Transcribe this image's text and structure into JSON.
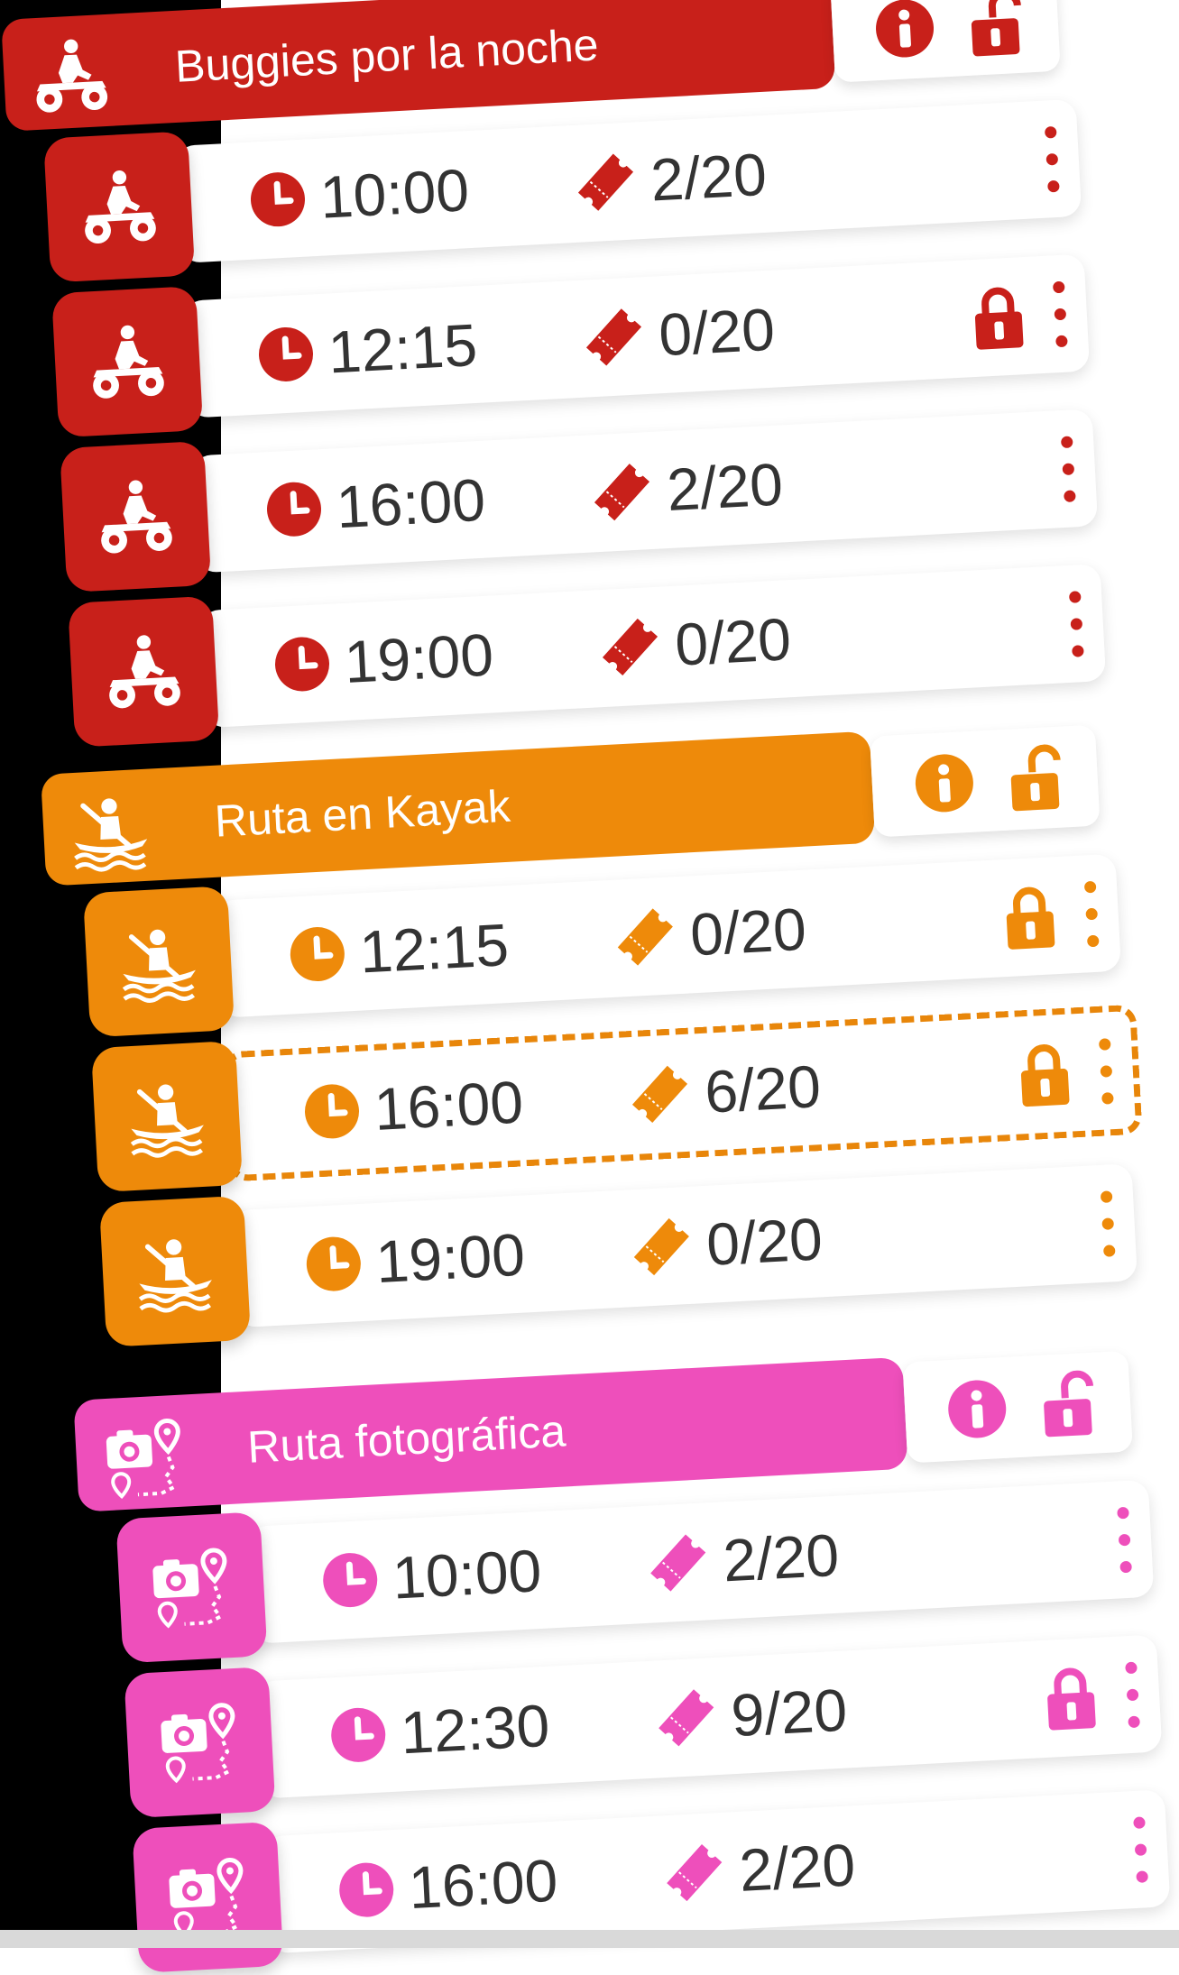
{
  "colors": {
    "buggies": "#c8201a",
    "kayak": "#ee8a0a",
    "foto": "#ee4fbb",
    "text": "#333333"
  },
  "groups": [
    {
      "title": "Buggies por la noche",
      "icon": "quad-bike-icon",
      "color": "#c8201a",
      "slots": [
        {
          "time": "10:00",
          "tickets": "2/20",
          "locked": false,
          "selected": false
        },
        {
          "time": "12:15",
          "tickets": "0/20",
          "locked": true,
          "selected": false
        },
        {
          "time": "16:00",
          "tickets": "2/20",
          "locked": false,
          "selected": false
        },
        {
          "time": "19:00",
          "tickets": "0/20",
          "locked": false,
          "selected": false
        }
      ]
    },
    {
      "title": "Ruta en Kayak",
      "icon": "kayak-icon",
      "color": "#ee8a0a",
      "slots": [
        {
          "time": "12:15",
          "tickets": "0/20",
          "locked": true,
          "selected": false
        },
        {
          "time": "16:00",
          "tickets": "6/20",
          "locked": true,
          "selected": true
        },
        {
          "time": "19:00",
          "tickets": "0/20",
          "locked": false,
          "selected": false
        }
      ]
    },
    {
      "title": "Ruta fotográfica",
      "icon": "camera-route-icon",
      "color": "#ee4fbb",
      "slots": [
        {
          "time": "10:00",
          "tickets": "2/20",
          "locked": false,
          "selected": false
        },
        {
          "time": "12:30",
          "tickets": "9/20",
          "locked": true,
          "selected": false
        },
        {
          "time": "16:00",
          "tickets": "2/20",
          "locked": false,
          "selected": false
        }
      ]
    }
  ]
}
